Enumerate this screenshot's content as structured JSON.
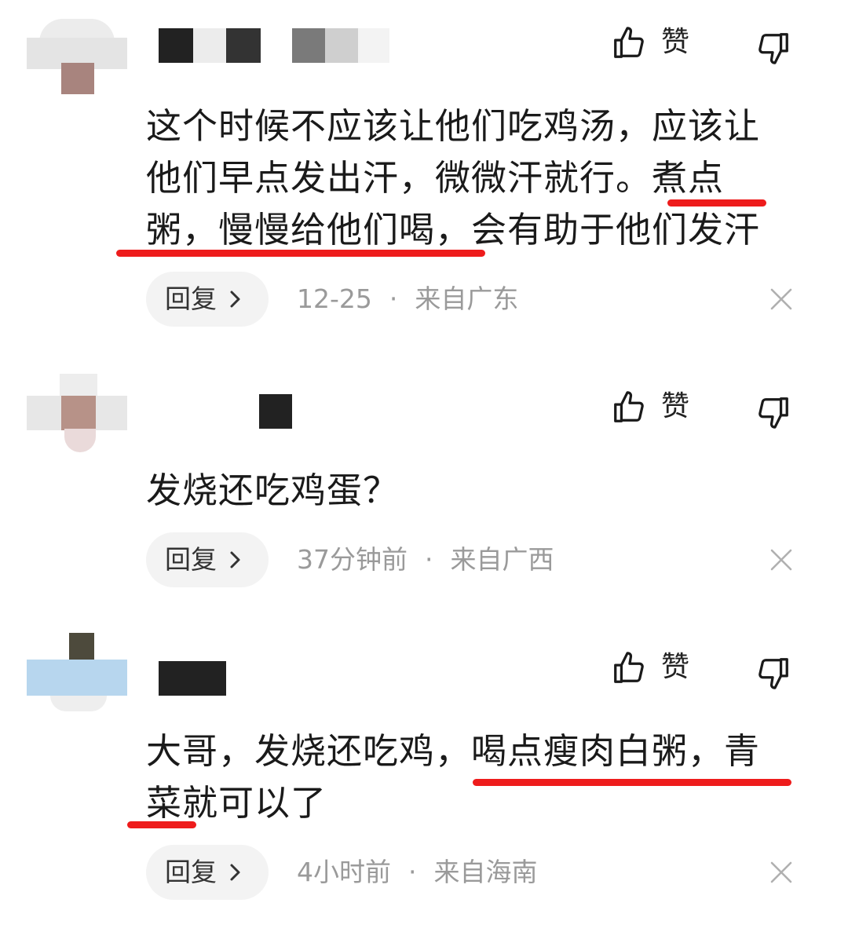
{
  "comments": [
    {
      "like_label": "赞",
      "text_lines": [
        "这个时候不应该让他们吃鸡汤，应该让",
        "他们早点发出汗，微微汗就行。煮点",
        "粥，慢慢给他们喝，会有助于他们发汗"
      ],
      "reply_label": "回复",
      "date": "12-25",
      "separator": "·",
      "location": "来自广东"
    },
    {
      "like_label": "赞",
      "text_lines": [
        "发烧还吃鸡蛋？"
      ],
      "reply_label": "回复",
      "date": "37分钟前",
      "separator": "·",
      "location": "来自广西"
    },
    {
      "like_label": "赞",
      "text_lines": [
        "大哥，发烧还吃鸡，喝点瘦肉白粥，青",
        "菜就可以了"
      ],
      "reply_label": "回复",
      "date": "4小时前",
      "separator": "·",
      "location": "来自海南"
    }
  ],
  "icons": {
    "like": "thumbs-up-icon",
    "dislike": "thumbs-down-icon",
    "chevron": "chevron-right-icon",
    "close": "close-icon"
  },
  "colors": {
    "highlight_underline": "#ee1c1c",
    "meta_text": "#9a9a9a",
    "reply_pill": "#f3f3f3"
  }
}
